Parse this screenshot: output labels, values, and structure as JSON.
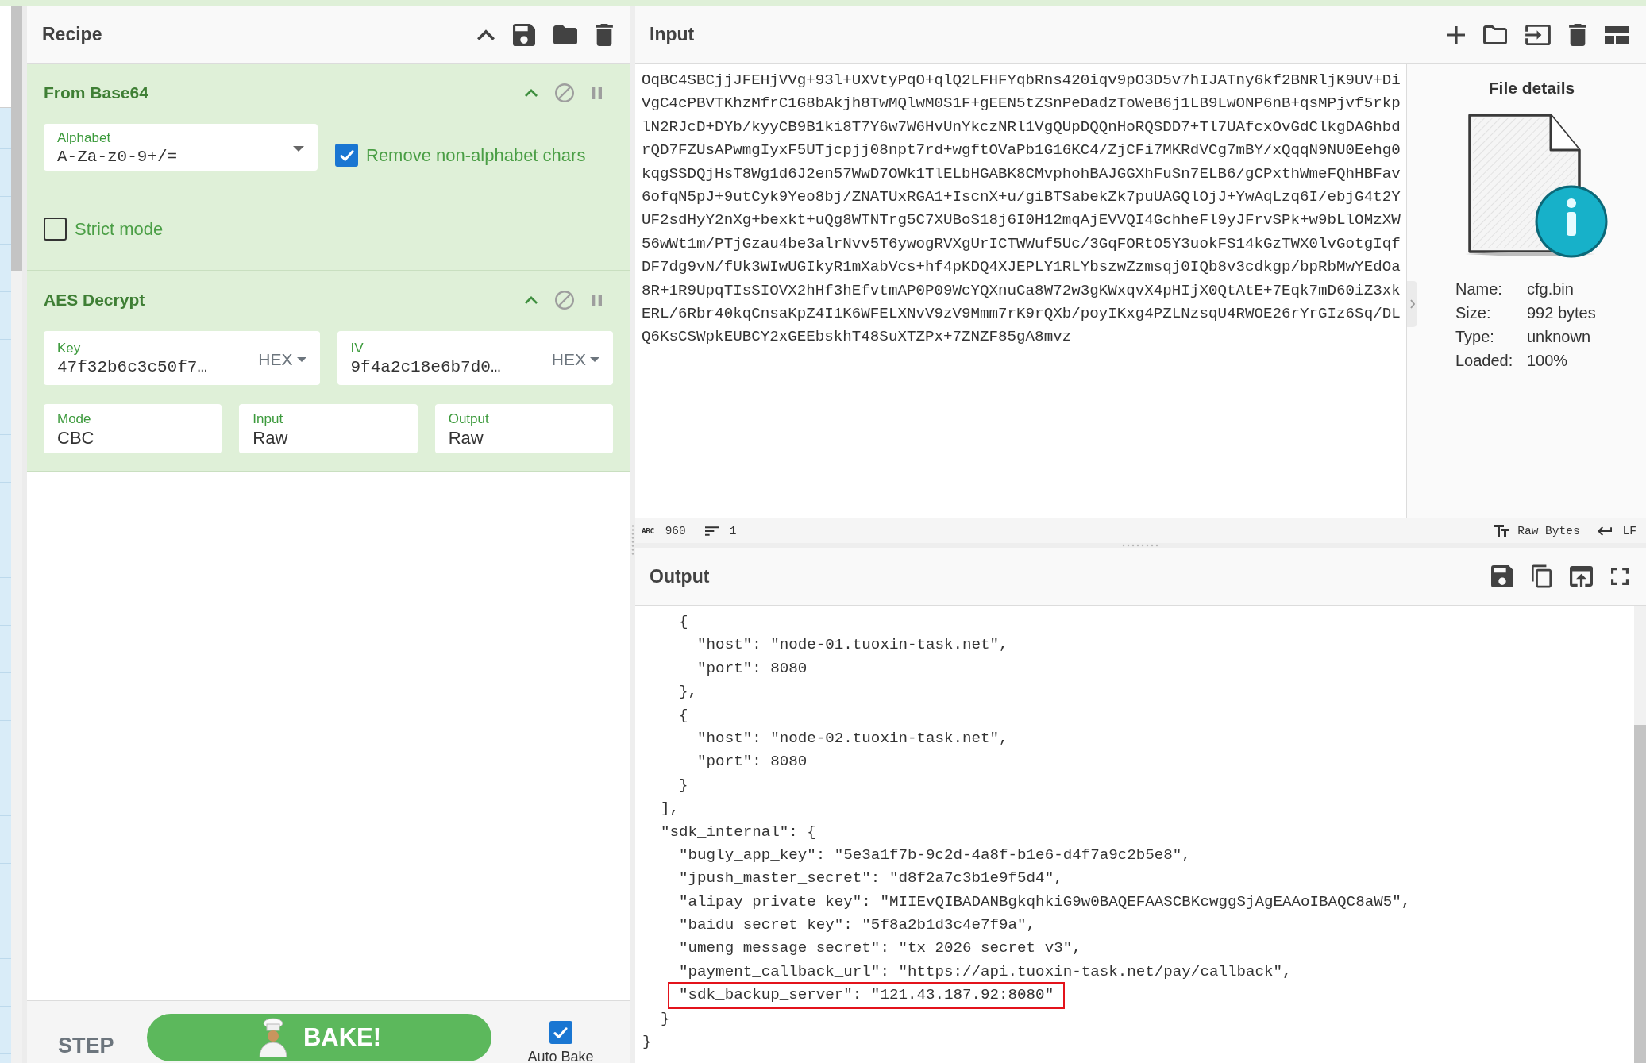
{
  "recipe": {
    "title": "Recipe",
    "operations": [
      {
        "title": "From Base64",
        "args": [
          {
            "kind": "select",
            "label": "Alphabet",
            "value": "A-Za-z0-9+/="
          },
          {
            "kind": "checkbox",
            "label": "Remove non-alphabet chars",
            "checked": true
          },
          {
            "kind": "checkbox",
            "label": "Strict mode",
            "checked": false
          }
        ]
      },
      {
        "title": "AES Decrypt",
        "args": [
          {
            "kind": "toggle_string",
            "label": "Key",
            "value": "47f32b6c3c50f7…",
            "option": "HEX"
          },
          {
            "kind": "toggle_string",
            "label": "IV",
            "value": "9f4a2c18e6b7d0…",
            "option": "HEX"
          },
          {
            "kind": "option",
            "label": "Mode",
            "value": "CBC"
          },
          {
            "kind": "option",
            "label": "Input",
            "value": "Raw"
          },
          {
            "kind": "option",
            "label": "Output",
            "value": "Raw"
          }
        ]
      }
    ],
    "controls": {
      "step": "STEP",
      "bake": "BAKE!",
      "auto_bake": {
        "label": "Auto Bake",
        "checked": true
      }
    }
  },
  "input": {
    "title": "Input",
    "text": "OqBC4SBCjjJFEHjVVg+93l+UXVtyPqO+qlQ2LFHFYqbRns420iqv9pO3D5v7hIJATny6kf2BNRljK9UV+DiVgC4cPBVTKhzMfrC1G8bAkjh8TwMQlwM0S1F+gEEN5tZSnPeDadzToWeB6j1LB9LwONP6nB+qsMPjvf5rkplN2RJcD+DYb/kyyCB9B1ki8T7Y6w7W6HvUnYkczNRl1VgQUpDQQnHoRQSDD7+Tl7UAfcxOvGdClkgDAGhbdrQD7FZUsAPwmgIyxF5UTjcpjj08npt7rd+wgftOVaPb1G16KC4/ZjCFi7MKRdVCg7mBY/xQqqN9NU0Eehg0kqgSSDQjHsT8Wg1d6J2en57WwD7OWk1TlELbHGABK8CMvphohBAJGGXhFuSn7ELB6/gCPxthWmeFQhHBFav6ofqN5pJ+9utCyk9Yeo8bj/ZNATUxRGA1+IscnX+u/giBTSabekZk7puUAGQlOjJ+YwAqLzq6I/ebjG4t2YUF2sdHyY2nXg+bexkt+uQg8WTNTrg5C7XUBoS18j6I0H12mqAjEVVQI4GchheFl9yJFrvSPk+w9bLlOMzXW56wWt1m/PTjGzau4be3alrNvv5T6ywogRVXgUrICTWWuf5Uc/3GqFORtO5Y3uokFS14kGzTWX0lvGotgIqfDF7dg9vN/fUk3WIwUGIkyR1mXabVcs+hf4pKDQ4XJEPLY1RLYbszwZzmsqj0IQb8v3cdkgp/bpRbMwYEdOa8R+1R9UpqTIsSIOVX2hHf3hEfvtmAP0P09WcYQXnuCa8W72w3gKWxqvX4pHIjX0QtAtE+7Eqk7mD60iZ3xkERL/6Rbr40kqCnsaKpZ4I1K6WFELXNvV9zV9Mmm7rK9rQXb/poyIKxg4PZLNzsqU4RWOE26rYrGIz6Sq/DLQ6KsCSWpkEUBCY2xGEEbskhT48SuXTZPx+7ZNZF85gA8mvz",
    "file_details": {
      "title": "File details",
      "rows": [
        {
          "label": "Name:",
          "value": "cfg.bin"
        },
        {
          "label": "Size:",
          "value": "992 bytes"
        },
        {
          "label": "Type:",
          "value": "unknown"
        },
        {
          "label": "Loaded:",
          "value": "100%"
        }
      ]
    },
    "status_bar": {
      "length_marker": "ABC",
      "length": "960",
      "lines": "1",
      "format": "Raw Bytes",
      "line_ending": "LF"
    }
  },
  "output": {
    "title": "Output",
    "lines": [
      {
        "text": "    {",
        "highlighted": false
      },
      {
        "text": "      \"host\": \"node-01.tuoxin-task.net\",",
        "highlighted": false
      },
      {
        "text": "      \"port\": 8080",
        "highlighted": false
      },
      {
        "text": "    },",
        "highlighted": false
      },
      {
        "text": "    {",
        "highlighted": false
      },
      {
        "text": "      \"host\": \"node-02.tuoxin-task.net\",",
        "highlighted": false
      },
      {
        "text": "      \"port\": 8080",
        "highlighted": false
      },
      {
        "text": "    }",
        "highlighted": false
      },
      {
        "text": "  ],",
        "highlighted": false
      },
      {
        "text": "  \"sdk_internal\": {",
        "highlighted": false
      },
      {
        "text": "    \"bugly_app_key\": \"5e3a1f7b-9c2d-4a8f-b1e6-d4f7a9c2b5e8\",",
        "highlighted": false
      },
      {
        "text": "    \"jpush_master_secret\": \"d8f2a7c3b1e9f5d4\",",
        "highlighted": false
      },
      {
        "text": "    \"alipay_private_key\": \"MIIEvQIBADANBgkqhkiG9w0BAQEFAASCBKcwggSjAgEAAoIBAQC8aW5\",",
        "highlighted": false
      },
      {
        "text": "    \"baidu_secret_key\": \"5f8a2b1d3c4e7f9a\",",
        "highlighted": false
      },
      {
        "text": "    \"umeng_message_secret\": \"tx_2026_secret_v3\",",
        "highlighted": false
      },
      {
        "text": "    \"payment_callback_url\": \"https://api.tuoxin-task.net/pay/callback\",",
        "highlighted": false
      },
      {
        "text": "    \"sdk_backup_server\": \"121.43.187.92:8080\"",
        "highlighted": true
      },
      {
        "text": "  }",
        "highlighted": false
      },
      {
        "text": "}",
        "highlighted": false
      }
    ]
  }
}
